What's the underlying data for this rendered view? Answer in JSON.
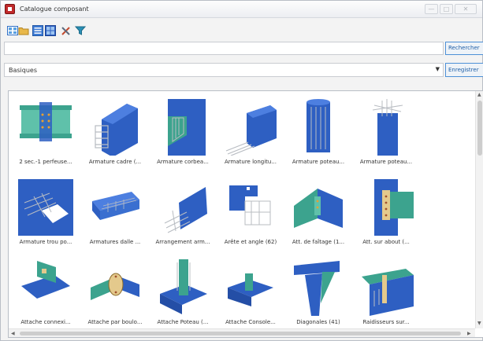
{
  "window": {
    "title": "Catalogue composant",
    "controls": {
      "minimize": "—",
      "maximize": "□",
      "close": "✕"
    }
  },
  "toolbar": {
    "icons": [
      "view-large-icon",
      "folder-icon",
      "view-list-icon",
      "view-details-icon",
      "tools-icon",
      "filter-icon"
    ]
  },
  "search": {
    "value": "",
    "placeholder": "",
    "button_label": "Rechercher"
  },
  "category": {
    "selected": "Basiques",
    "save_label": "Enregistrer"
  },
  "catalog": {
    "items": [
      {
        "label": "2 sec.-1 perfeuse...",
        "icon": "beam-splice-plates"
      },
      {
        "label": "Armature cadre (...",
        "icon": "column-rebar-cage"
      },
      {
        "label": "Armature corbea...",
        "icon": "corbel-rebar"
      },
      {
        "label": "Armature longitu...",
        "icon": "longitudinal-rebar"
      },
      {
        "label": "Armature poteau...",
        "icon": "round-column-rebar"
      },
      {
        "label": "Armature poteau...",
        "icon": "column-rebar-top"
      },
      {
        "label": "Armature trou po...",
        "icon": "slab-opening-rebar"
      },
      {
        "label": "Armatures dalle ...",
        "icon": "slab-rebar"
      },
      {
        "label": "Arrangement arm...",
        "icon": "rebar-arrangement"
      },
      {
        "label": "Arête et angle (62)",
        "icon": "edge-and-corner"
      },
      {
        "label": "Att. de faîtage (1...",
        "icon": "ridge-connection"
      },
      {
        "label": "Att. sur about (...",
        "icon": "end-plate-connection"
      },
      {
        "label": "Attache connexi...",
        "icon": "purlin-connection"
      },
      {
        "label": "Attache par boulo...",
        "icon": "bolted-pipe-connection"
      },
      {
        "label": "Attache Poteau (...",
        "icon": "column-base-plate"
      },
      {
        "label": "Attache Console...",
        "icon": "console-connection"
      },
      {
        "label": "Diagonales (41)",
        "icon": "diagonal-bracing"
      },
      {
        "label": "Raidisseurs sur...",
        "icon": "stiffeners"
      }
    ]
  },
  "colors": {
    "accent": "#4d90d6",
    "beam_blue": "#2e5fc2",
    "plate_teal": "#3ca38e",
    "rebar_gray": "#b8bcc2"
  }
}
